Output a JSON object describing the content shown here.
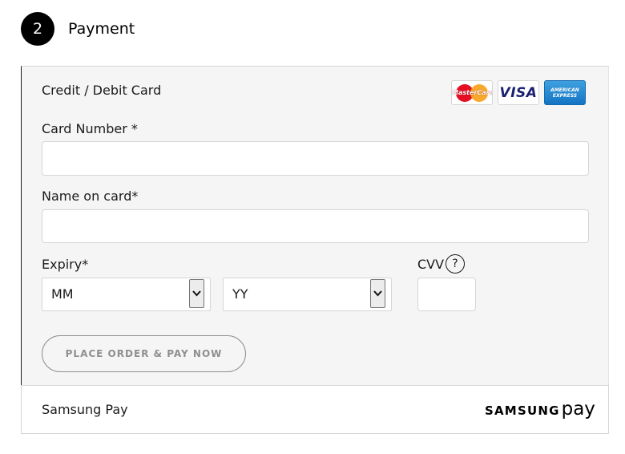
{
  "step": {
    "number": "2",
    "title": "Payment"
  },
  "card_section": {
    "title": "Credit / Debit Card",
    "logos": {
      "mastercard": "MasterCard",
      "visa": "VISA",
      "amex": "AMERICAN EXPRESS"
    },
    "card_number": {
      "label": "Card Number *",
      "value": ""
    },
    "name_on_card": {
      "label": "Name on card*",
      "value": ""
    },
    "expiry": {
      "label": "Expiry*",
      "month_selected": "MM",
      "year_selected": "YY"
    },
    "cvv": {
      "label": "CVV",
      "help": "?",
      "value": ""
    },
    "place_order_label": "PLACE ORDER & PAY NOW"
  },
  "samsung_pay": {
    "label": "Samsung Pay",
    "logo_samsung": "SAMSUNG",
    "logo_pay": "pay"
  },
  "colors": {
    "section_bg": "#f5f5f5",
    "border": "#d6d6d6",
    "disabled_button_text": "#8f8f8f",
    "badge_bg": "#000000"
  },
  "icons": [
    "chevron-down-icon",
    "help-icon",
    "mastercard-logo",
    "visa-logo",
    "amex-logo",
    "samsung-pay-logo"
  ]
}
